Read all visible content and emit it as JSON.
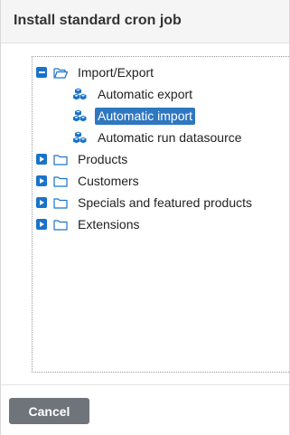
{
  "dialog": {
    "title": "Install standard cron job"
  },
  "tree": {
    "import_export": {
      "label": "Import/Export",
      "expanded": true,
      "children": [
        {
          "label": "Automatic export",
          "selected": false
        },
        {
          "label": "Automatic import",
          "selected": true
        },
        {
          "label": "Automatic run datasource",
          "selected": false
        }
      ]
    },
    "collapsed": [
      {
        "label": "Products"
      },
      {
        "label": "Customers"
      },
      {
        "label": "Specials and featured products"
      },
      {
        "label": "Extensions"
      }
    ]
  },
  "footer": {
    "cancel_label": "Cancel"
  },
  "colors": {
    "accent": "#1a73c9",
    "selected_bg": "#2f77bf",
    "button_bg": "#6f747a"
  }
}
